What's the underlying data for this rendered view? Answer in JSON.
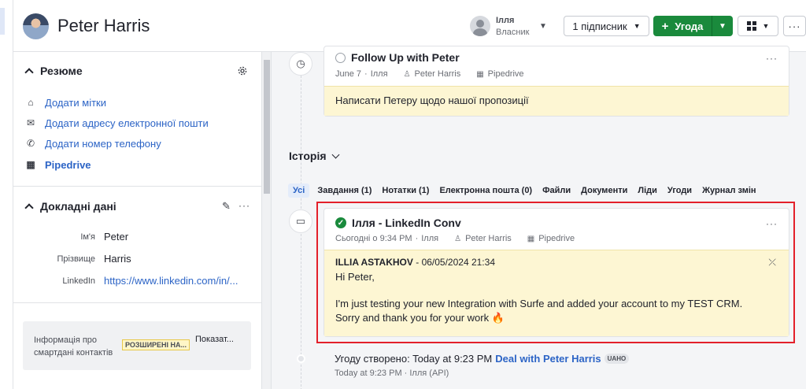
{
  "header": {
    "person_name": "Peter Harris",
    "owner": {
      "name": "Ілля",
      "role": "Власник"
    },
    "follow_button": "1 підписник",
    "deal_button": "Угода",
    "more_label": "···"
  },
  "sidebar": {
    "summary": {
      "title": "Резюме",
      "links": [
        {
          "icon": "tag-icon",
          "label": "Додати мітки"
        },
        {
          "icon": "mail-icon",
          "label": "Додати адресу електронної пошти"
        },
        {
          "icon": "phone-icon",
          "label": "Додати номер телефону"
        },
        {
          "icon": "building-icon",
          "label": "Pipedrive"
        }
      ]
    },
    "details": {
      "title": "Докладні дані",
      "fields": [
        {
          "label": "Ім'я",
          "value": "Peter"
        },
        {
          "label": "Прізвище",
          "value": "Harris"
        },
        {
          "label": "LinkedIn",
          "value": "https://www.linkedin.com/in/..."
        }
      ]
    },
    "smart": {
      "text": "Інформація про смартдані контактів",
      "badge": "РОЗШИРЕНІ НА...",
      "show": "Показат..."
    }
  },
  "main": {
    "followup": {
      "title": "Follow Up with Peter",
      "date": "June 7",
      "user": "Ілля",
      "person": "Peter Harris",
      "org": "Pipedrive",
      "note": "Написати Петеру щодо нашої пропозиції"
    },
    "history": {
      "title": "Історія",
      "filters": [
        "Усі",
        "Завдання (1)",
        "Нотатки (1)",
        "Електронна пошта (0)",
        "Файли",
        "Документи",
        "Ліди",
        "Угоди",
        "Журнал змін"
      ]
    },
    "linkedin_note": {
      "title": "Ілля - LinkedIn Conv",
      "date": "Сьогодні о 9:34 PM",
      "user": "Ілля",
      "person": "Peter Harris",
      "org": "Pipedrive",
      "author": "ILLIA ASTAKHOV",
      "author_date": "- 06/05/2024 21:34",
      "greeting": "Hi Peter,",
      "body": "I'm just testing your new Integration with Surfe and added your account to my TEST CRM. Sorry and thank you for your work 🔥"
    },
    "deal_event": {
      "prefix": "Угоду створено",
      "time": ": Today at 9:23 PM",
      "link": "Deal with Peter Harris",
      "badge": "UAHO",
      "meta": "Today at 9:23 PM · Ілля (API)"
    }
  },
  "colors": {
    "accent": "#2c64c6",
    "primary_green": "#1a8a3c",
    "note_bg": "#fdf6d3",
    "highlight": "#e3202a"
  }
}
